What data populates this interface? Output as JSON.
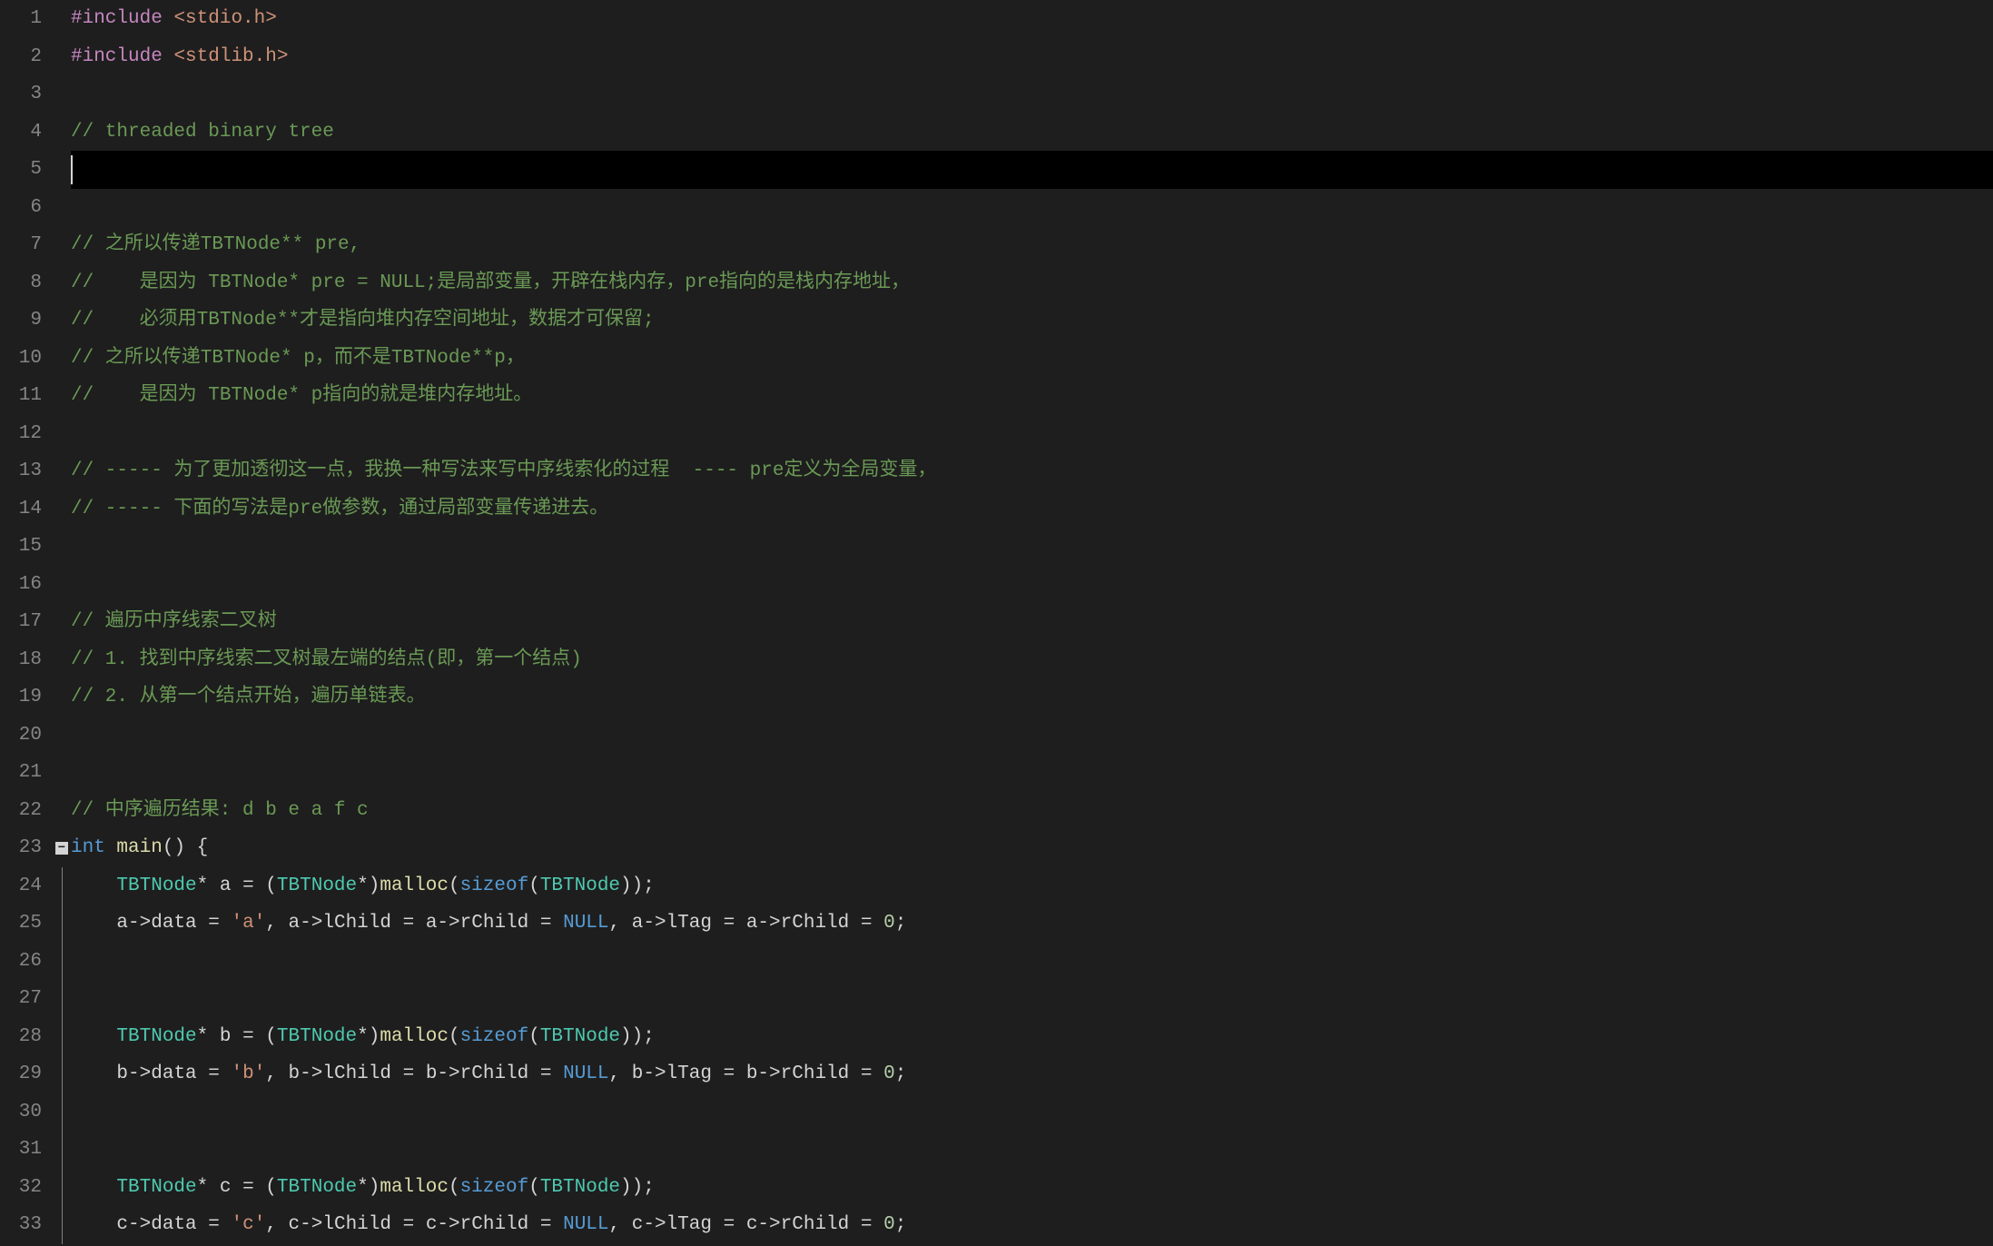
{
  "editor": {
    "lineCount": 33,
    "currentLine": 5,
    "foldMarkerLine": 23,
    "lines": [
      {
        "n": 1,
        "tokens": [
          {
            "cls": "tok-preproc",
            "t": "#include"
          },
          {
            "cls": "tok-punct",
            "t": " "
          },
          {
            "cls": "tok-include-path",
            "t": "<stdio.h>"
          }
        ]
      },
      {
        "n": 2,
        "tokens": [
          {
            "cls": "tok-preproc",
            "t": "#include"
          },
          {
            "cls": "tok-punct",
            "t": " "
          },
          {
            "cls": "tok-include-path",
            "t": "<stdlib.h>"
          }
        ]
      },
      {
        "n": 3,
        "tokens": []
      },
      {
        "n": 4,
        "tokens": [
          {
            "cls": "tok-comment",
            "t": "// threaded binary tree"
          }
        ]
      },
      {
        "n": 5,
        "tokens": [],
        "current": true
      },
      {
        "n": 6,
        "tokens": []
      },
      {
        "n": 7,
        "tokens": [
          {
            "cls": "tok-comment",
            "t": "// 之所以传递TBTNode** pre,"
          }
        ]
      },
      {
        "n": 8,
        "tokens": [
          {
            "cls": "tok-comment",
            "t": "//    是因为 TBTNode* pre = NULL;是局部变量，开辟在栈内存，pre指向的是栈内存地址，"
          }
        ]
      },
      {
        "n": 9,
        "tokens": [
          {
            "cls": "tok-comment",
            "t": "//    必须用TBTNode**才是指向堆内存空间地址，数据才可保留;"
          }
        ]
      },
      {
        "n": 10,
        "tokens": [
          {
            "cls": "tok-comment",
            "t": "// 之所以传递TBTNode* p，而不是TBTNode**p，"
          }
        ]
      },
      {
        "n": 11,
        "tokens": [
          {
            "cls": "tok-comment",
            "t": "//    是因为 TBTNode* p指向的就是堆内存地址。"
          }
        ]
      },
      {
        "n": 12,
        "tokens": []
      },
      {
        "n": 13,
        "tokens": [
          {
            "cls": "tok-comment",
            "t": "// ----- 为了更加透彻这一点，我换一种写法来写中序线索化的过程  ---- pre定义为全局变量，"
          }
        ]
      },
      {
        "n": 14,
        "tokens": [
          {
            "cls": "tok-comment",
            "t": "// ----- 下面的写法是pre做参数，通过局部变量传递进去。"
          }
        ]
      },
      {
        "n": 15,
        "tokens": []
      },
      {
        "n": 16,
        "tokens": []
      },
      {
        "n": 17,
        "tokens": [
          {
            "cls": "tok-comment",
            "t": "// 遍历中序线索二叉树"
          }
        ]
      },
      {
        "n": 18,
        "tokens": [
          {
            "cls": "tok-comment",
            "t": "// 1. 找到中序线索二叉树最左端的结点(即，第一个结点)"
          }
        ]
      },
      {
        "n": 19,
        "tokens": [
          {
            "cls": "tok-comment",
            "t": "// 2. 从第一个结点开始，遍历单链表。"
          }
        ]
      },
      {
        "n": 20,
        "tokens": []
      },
      {
        "n": 21,
        "tokens": []
      },
      {
        "n": 22,
        "tokens": [
          {
            "cls": "tok-comment",
            "t": "// 中序遍历结果: d b e a f c"
          }
        ]
      },
      {
        "n": 23,
        "tokens": [
          {
            "cls": "tok-keyword",
            "t": "int"
          },
          {
            "cls": "tok-punct",
            "t": " "
          },
          {
            "cls": "tok-func",
            "t": "main"
          },
          {
            "cls": "tok-punct",
            "t": "() {"
          }
        ]
      },
      {
        "n": 24,
        "tokens": [
          {
            "cls": "tok-punct",
            "t": "    "
          },
          {
            "cls": "tok-type",
            "t": "TBTNode"
          },
          {
            "cls": "tok-operator",
            "t": "*"
          },
          {
            "cls": "tok-punct",
            "t": " "
          },
          {
            "cls": "tok-ident",
            "t": "a"
          },
          {
            "cls": "tok-punct",
            "t": " "
          },
          {
            "cls": "tok-operator",
            "t": "="
          },
          {
            "cls": "tok-punct",
            "t": " ("
          },
          {
            "cls": "tok-type",
            "t": "TBTNode"
          },
          {
            "cls": "tok-operator",
            "t": "*"
          },
          {
            "cls": "tok-punct",
            "t": ")"
          },
          {
            "cls": "tok-func",
            "t": "malloc"
          },
          {
            "cls": "tok-punct",
            "t": "("
          },
          {
            "cls": "tok-sizeof",
            "t": "sizeof"
          },
          {
            "cls": "tok-punct",
            "t": "("
          },
          {
            "cls": "tok-type",
            "t": "TBTNode"
          },
          {
            "cls": "tok-punct",
            "t": "));"
          }
        ]
      },
      {
        "n": 25,
        "tokens": [
          {
            "cls": "tok-punct",
            "t": "    "
          },
          {
            "cls": "tok-ident",
            "t": "a"
          },
          {
            "cls": "tok-operator",
            "t": "->"
          },
          {
            "cls": "tok-ident",
            "t": "data"
          },
          {
            "cls": "tok-punct",
            "t": " "
          },
          {
            "cls": "tok-operator",
            "t": "="
          },
          {
            "cls": "tok-punct",
            "t": " "
          },
          {
            "cls": "tok-string",
            "t": "'a'"
          },
          {
            "cls": "tok-punct",
            "t": ", "
          },
          {
            "cls": "tok-ident",
            "t": "a"
          },
          {
            "cls": "tok-operator",
            "t": "->"
          },
          {
            "cls": "tok-ident",
            "t": "lChild"
          },
          {
            "cls": "tok-punct",
            "t": " "
          },
          {
            "cls": "tok-operator",
            "t": "="
          },
          {
            "cls": "tok-punct",
            "t": " "
          },
          {
            "cls": "tok-ident",
            "t": "a"
          },
          {
            "cls": "tok-operator",
            "t": "->"
          },
          {
            "cls": "tok-ident",
            "t": "rChild"
          },
          {
            "cls": "tok-punct",
            "t": " "
          },
          {
            "cls": "tok-operator",
            "t": "="
          },
          {
            "cls": "tok-punct",
            "t": " "
          },
          {
            "cls": "tok-null",
            "t": "NULL"
          },
          {
            "cls": "tok-punct",
            "t": ", "
          },
          {
            "cls": "tok-ident",
            "t": "a"
          },
          {
            "cls": "tok-operator",
            "t": "->"
          },
          {
            "cls": "tok-ident",
            "t": "lTag"
          },
          {
            "cls": "tok-punct",
            "t": " "
          },
          {
            "cls": "tok-operator",
            "t": "="
          },
          {
            "cls": "tok-punct",
            "t": " "
          },
          {
            "cls": "tok-ident",
            "t": "a"
          },
          {
            "cls": "tok-operator",
            "t": "->"
          },
          {
            "cls": "tok-ident",
            "t": "rChild"
          },
          {
            "cls": "tok-punct",
            "t": " "
          },
          {
            "cls": "tok-operator",
            "t": "="
          },
          {
            "cls": "tok-punct",
            "t": " "
          },
          {
            "cls": "tok-number",
            "t": "0"
          },
          {
            "cls": "tok-punct",
            "t": ";"
          }
        ]
      },
      {
        "n": 26,
        "tokens": []
      },
      {
        "n": 27,
        "tokens": []
      },
      {
        "n": 28,
        "tokens": [
          {
            "cls": "tok-punct",
            "t": "    "
          },
          {
            "cls": "tok-type",
            "t": "TBTNode"
          },
          {
            "cls": "tok-operator",
            "t": "*"
          },
          {
            "cls": "tok-punct",
            "t": " "
          },
          {
            "cls": "tok-ident",
            "t": "b"
          },
          {
            "cls": "tok-punct",
            "t": " "
          },
          {
            "cls": "tok-operator",
            "t": "="
          },
          {
            "cls": "tok-punct",
            "t": " ("
          },
          {
            "cls": "tok-type",
            "t": "TBTNode"
          },
          {
            "cls": "tok-operator",
            "t": "*"
          },
          {
            "cls": "tok-punct",
            "t": ")"
          },
          {
            "cls": "tok-func",
            "t": "malloc"
          },
          {
            "cls": "tok-punct",
            "t": "("
          },
          {
            "cls": "tok-sizeof",
            "t": "sizeof"
          },
          {
            "cls": "tok-punct",
            "t": "("
          },
          {
            "cls": "tok-type",
            "t": "TBTNode"
          },
          {
            "cls": "tok-punct",
            "t": "));"
          }
        ]
      },
      {
        "n": 29,
        "tokens": [
          {
            "cls": "tok-punct",
            "t": "    "
          },
          {
            "cls": "tok-ident",
            "t": "b"
          },
          {
            "cls": "tok-operator",
            "t": "->"
          },
          {
            "cls": "tok-ident",
            "t": "data"
          },
          {
            "cls": "tok-punct",
            "t": " "
          },
          {
            "cls": "tok-operator",
            "t": "="
          },
          {
            "cls": "tok-punct",
            "t": " "
          },
          {
            "cls": "tok-string",
            "t": "'b'"
          },
          {
            "cls": "tok-punct",
            "t": ", "
          },
          {
            "cls": "tok-ident",
            "t": "b"
          },
          {
            "cls": "tok-operator",
            "t": "->"
          },
          {
            "cls": "tok-ident",
            "t": "lChild"
          },
          {
            "cls": "tok-punct",
            "t": " "
          },
          {
            "cls": "tok-operator",
            "t": "="
          },
          {
            "cls": "tok-punct",
            "t": " "
          },
          {
            "cls": "tok-ident",
            "t": "b"
          },
          {
            "cls": "tok-operator",
            "t": "->"
          },
          {
            "cls": "tok-ident",
            "t": "rChild"
          },
          {
            "cls": "tok-punct",
            "t": " "
          },
          {
            "cls": "tok-operator",
            "t": "="
          },
          {
            "cls": "tok-punct",
            "t": " "
          },
          {
            "cls": "tok-null",
            "t": "NULL"
          },
          {
            "cls": "tok-punct",
            "t": ", "
          },
          {
            "cls": "tok-ident",
            "t": "b"
          },
          {
            "cls": "tok-operator",
            "t": "->"
          },
          {
            "cls": "tok-ident",
            "t": "lTag"
          },
          {
            "cls": "tok-punct",
            "t": " "
          },
          {
            "cls": "tok-operator",
            "t": "="
          },
          {
            "cls": "tok-punct",
            "t": " "
          },
          {
            "cls": "tok-ident",
            "t": "b"
          },
          {
            "cls": "tok-operator",
            "t": "->"
          },
          {
            "cls": "tok-ident",
            "t": "rChild"
          },
          {
            "cls": "tok-punct",
            "t": " "
          },
          {
            "cls": "tok-operator",
            "t": "="
          },
          {
            "cls": "tok-punct",
            "t": " "
          },
          {
            "cls": "tok-number",
            "t": "0"
          },
          {
            "cls": "tok-punct",
            "t": ";"
          }
        ]
      },
      {
        "n": 30,
        "tokens": []
      },
      {
        "n": 31,
        "tokens": []
      },
      {
        "n": 32,
        "tokens": [
          {
            "cls": "tok-punct",
            "t": "    "
          },
          {
            "cls": "tok-type",
            "t": "TBTNode"
          },
          {
            "cls": "tok-operator",
            "t": "*"
          },
          {
            "cls": "tok-punct",
            "t": " "
          },
          {
            "cls": "tok-ident",
            "t": "c"
          },
          {
            "cls": "tok-punct",
            "t": " "
          },
          {
            "cls": "tok-operator",
            "t": "="
          },
          {
            "cls": "tok-punct",
            "t": " ("
          },
          {
            "cls": "tok-type",
            "t": "TBTNode"
          },
          {
            "cls": "tok-operator",
            "t": "*"
          },
          {
            "cls": "tok-punct",
            "t": ")"
          },
          {
            "cls": "tok-func",
            "t": "malloc"
          },
          {
            "cls": "tok-punct",
            "t": "("
          },
          {
            "cls": "tok-sizeof",
            "t": "sizeof"
          },
          {
            "cls": "tok-punct",
            "t": "("
          },
          {
            "cls": "tok-type",
            "t": "TBTNode"
          },
          {
            "cls": "tok-punct",
            "t": "));"
          }
        ]
      },
      {
        "n": 33,
        "tokens": [
          {
            "cls": "tok-punct",
            "t": "    "
          },
          {
            "cls": "tok-ident",
            "t": "c"
          },
          {
            "cls": "tok-operator",
            "t": "->"
          },
          {
            "cls": "tok-ident",
            "t": "data"
          },
          {
            "cls": "tok-punct",
            "t": " "
          },
          {
            "cls": "tok-operator",
            "t": "="
          },
          {
            "cls": "tok-punct",
            "t": " "
          },
          {
            "cls": "tok-string",
            "t": "'c'"
          },
          {
            "cls": "tok-punct",
            "t": ", "
          },
          {
            "cls": "tok-ident",
            "t": "c"
          },
          {
            "cls": "tok-operator",
            "t": "->"
          },
          {
            "cls": "tok-ident",
            "t": "lChild"
          },
          {
            "cls": "tok-punct",
            "t": " "
          },
          {
            "cls": "tok-operator",
            "t": "="
          },
          {
            "cls": "tok-punct",
            "t": " "
          },
          {
            "cls": "tok-ident",
            "t": "c"
          },
          {
            "cls": "tok-operator",
            "t": "->"
          },
          {
            "cls": "tok-ident",
            "t": "rChild"
          },
          {
            "cls": "tok-punct",
            "t": " "
          },
          {
            "cls": "tok-operator",
            "t": "="
          },
          {
            "cls": "tok-punct",
            "t": " "
          },
          {
            "cls": "tok-null",
            "t": "NULL"
          },
          {
            "cls": "tok-punct",
            "t": ", "
          },
          {
            "cls": "tok-ident",
            "t": "c"
          },
          {
            "cls": "tok-operator",
            "t": "->"
          },
          {
            "cls": "tok-ident",
            "t": "lTag"
          },
          {
            "cls": "tok-punct",
            "t": " "
          },
          {
            "cls": "tok-operator",
            "t": "="
          },
          {
            "cls": "tok-punct",
            "t": " "
          },
          {
            "cls": "tok-ident",
            "t": "c"
          },
          {
            "cls": "tok-operator",
            "t": "->"
          },
          {
            "cls": "tok-ident",
            "t": "rChild"
          },
          {
            "cls": "tok-punct",
            "t": " "
          },
          {
            "cls": "tok-operator",
            "t": "="
          },
          {
            "cls": "tok-punct",
            "t": " "
          },
          {
            "cls": "tok-number",
            "t": "0"
          },
          {
            "cls": "tok-punct",
            "t": ";"
          }
        ]
      }
    ]
  }
}
